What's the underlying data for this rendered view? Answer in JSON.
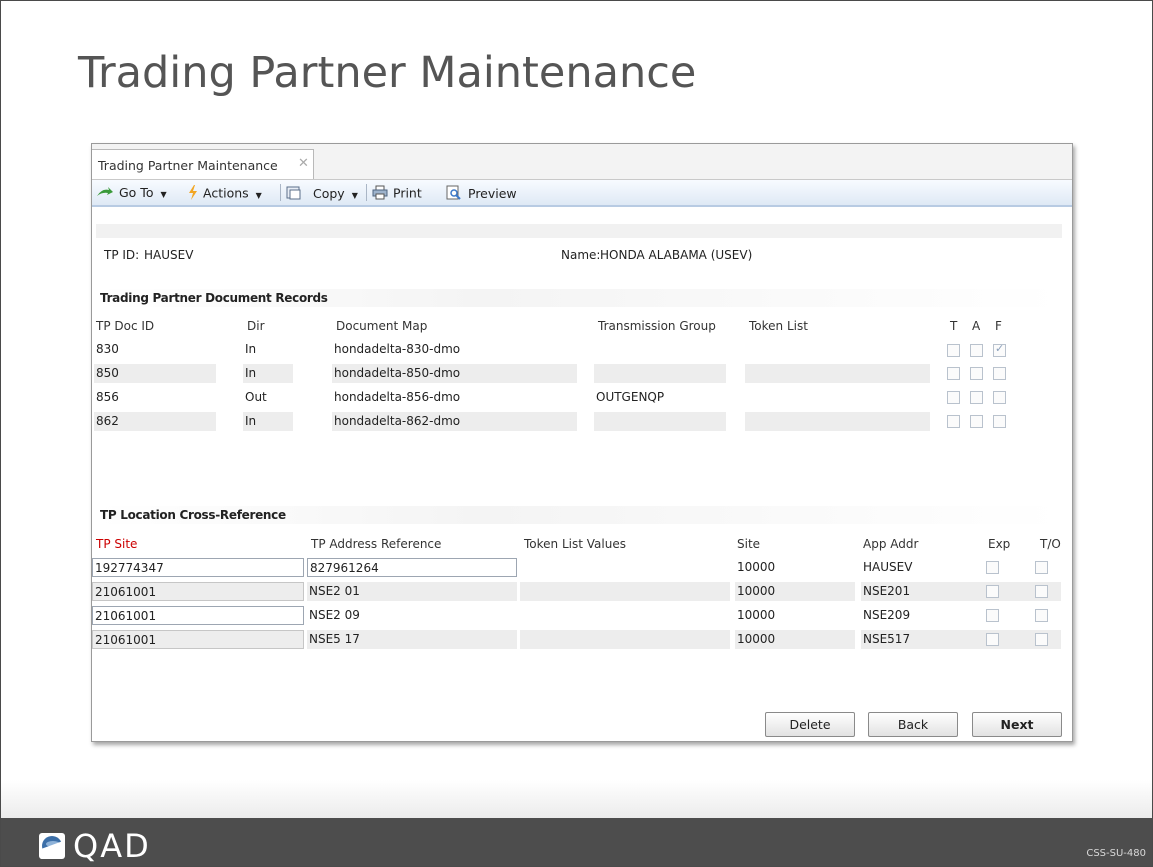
{
  "slide": {
    "title": "Trading Partner Maintenance",
    "logo_text": "QAD",
    "slide_code": "CSS-SU-480"
  },
  "app": {
    "tab_label": "Trading Partner Maintenance",
    "toolbar": {
      "goto_label": "Go To",
      "actions_label": "Actions",
      "copy_label": "Copy",
      "print_label": "Print",
      "preview_label": "Preview"
    },
    "header": {
      "tp_id_label": "TP ID:",
      "tp_id_value": "HAUSEV",
      "name_label": "Name:",
      "name_value": "HONDA ALABAMA (USEV)"
    },
    "doc_records": {
      "section_title": "Trading Partner Document Records",
      "columns": [
        "TP Doc ID",
        "Dir",
        "Document Map",
        "Transmission Group",
        "Token List",
        "T",
        "A",
        "F"
      ],
      "rows": [
        {
          "doc_id": "830",
          "dir": "In",
          "map": "hondadelta-830-dmo",
          "group": "",
          "token": "",
          "t": false,
          "a": false,
          "f": true
        },
        {
          "doc_id": "850",
          "dir": "In",
          "map": "hondadelta-850-dmo",
          "group": "",
          "token": "",
          "t": false,
          "a": false,
          "f": false
        },
        {
          "doc_id": "856",
          "dir": "Out",
          "map": "hondadelta-856-dmo",
          "group": "OUTGENQP",
          "token": "",
          "t": false,
          "a": false,
          "f": false
        },
        {
          "doc_id": "862",
          "dir": "In",
          "map": "hondadelta-862-dmo",
          "group": "",
          "token": "",
          "t": false,
          "a": false,
          "f": false
        }
      ]
    },
    "location_xref": {
      "section_title": "TP Location Cross-Reference",
      "columns": [
        "TP Site",
        "TP Address Reference",
        "Token List Values",
        "Site",
        "App Addr",
        "Exp",
        "T/O"
      ],
      "rows": [
        {
          "tp_site": "192774347",
          "addr_ref": "827961264",
          "token_values": "",
          "site": "10000",
          "app_addr": "HAUSEV",
          "exp": false,
          "to": false
        },
        {
          "tp_site": "21061001",
          "addr_ref": "NSE2 01",
          "token_values": "",
          "site": "10000",
          "app_addr": "NSE201",
          "exp": false,
          "to": false
        },
        {
          "tp_site": "21061001",
          "addr_ref": "NSE2 09",
          "token_values": "",
          "site": "10000",
          "app_addr": "NSE209",
          "exp": false,
          "to": false
        },
        {
          "tp_site": "21061001",
          "addr_ref": "NSE5 17",
          "token_values": "",
          "site": "10000",
          "app_addr": "NSE517",
          "exp": false,
          "to": false
        }
      ]
    },
    "buttons": {
      "delete": "Delete",
      "back": "Back",
      "next": "Next"
    },
    "colors": {
      "required_label": "#cc0000",
      "footer_bg": "#4d4d4d",
      "toolbar_accent": "#b8cbe3"
    }
  }
}
